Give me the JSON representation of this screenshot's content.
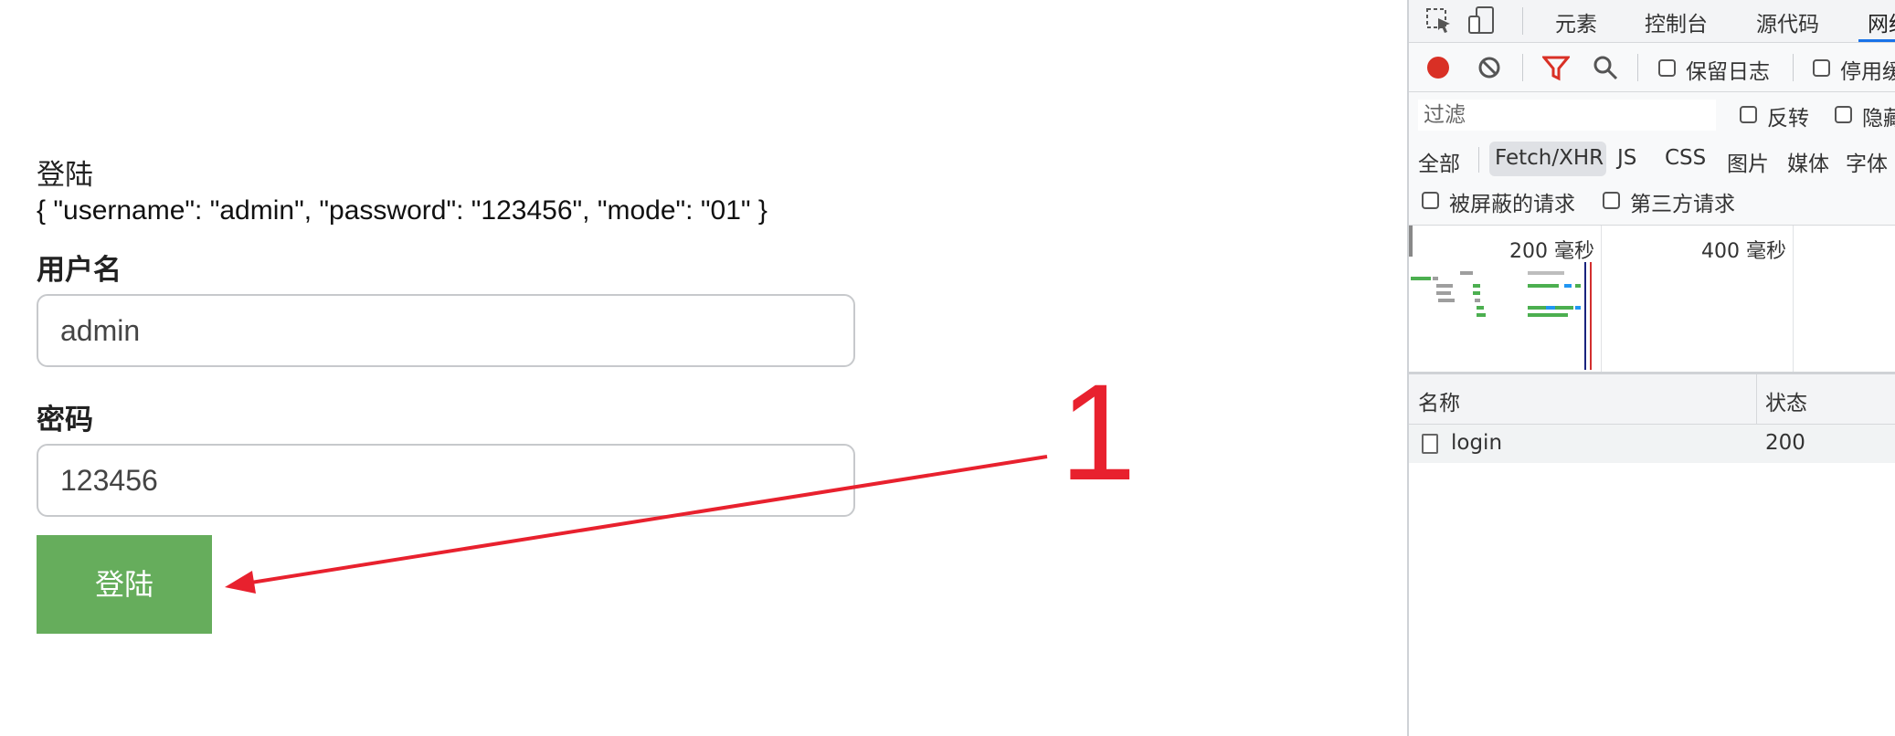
{
  "login": {
    "title": "登陆",
    "json_text": "{ \"username\": \"admin\", \"password\": \"123456\", \"mode\": \"01\" }",
    "username_label": "用户名",
    "username_value": "admin",
    "password_label": "密码",
    "password_value": "123456",
    "submit_label": "登陆"
  },
  "annotation": {
    "number": "1",
    "color": "#e8212e"
  },
  "devtools": {
    "tabs": [
      "元素",
      "控制台",
      "源代码",
      "网络"
    ],
    "active_tab": "网络",
    "toolbar": {
      "preserve_log": "保留日志",
      "disable_cache": "停用缓存"
    },
    "filter": {
      "placeholder": "过滤",
      "invert": "反转",
      "hide": "隐藏"
    },
    "types": [
      "全部",
      "Fetch/XHR",
      "JS",
      "CSS",
      "图片",
      "媒体",
      "字体"
    ],
    "active_type": "Fetch/XHR",
    "blocked_requests": "被屏蔽的请求",
    "third_party": "第三方请求",
    "timeline_ticks": [
      "200 毫秒",
      "400 毫秒"
    ],
    "columns": [
      "名称",
      "状态"
    ],
    "rows": [
      {
        "name": "login",
        "status": "200"
      }
    ],
    "colors": {
      "record": "#d93025",
      "filter": "#d93025",
      "active_tab_line": "#1a73e8"
    }
  }
}
